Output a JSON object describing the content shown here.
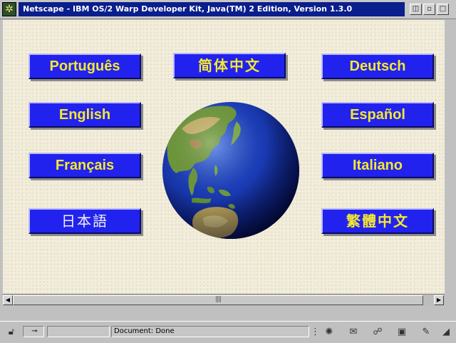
{
  "window": {
    "title": "Netscape - IBM OS/2 Warp Developer Kit, Java(TM) 2 Edition, Version 1.3.0",
    "controls": {
      "restore": "▯",
      "minimize": "▫",
      "maximize": "□"
    }
  },
  "languages": {
    "portugues": "Português",
    "simplified_chinese": "简体中文",
    "deutsch": "Deutsch",
    "english": "English",
    "espanol": "Español",
    "francais": "Français",
    "italiano": "Italiano",
    "japanese": "日本語",
    "traditional_chinese": "繁體中文"
  },
  "colors": {
    "button_face": "#2222ee",
    "button_text": "#f4e830",
    "background": "#f3eedb",
    "titlebar": "#0a1e8c"
  },
  "status": {
    "message": "Document: Done",
    "icons": [
      "lock-icon",
      "connection-icon",
      "navigator-icon",
      "mail-icon",
      "discussion-icon",
      "composer-icon",
      "edit-icon"
    ]
  }
}
